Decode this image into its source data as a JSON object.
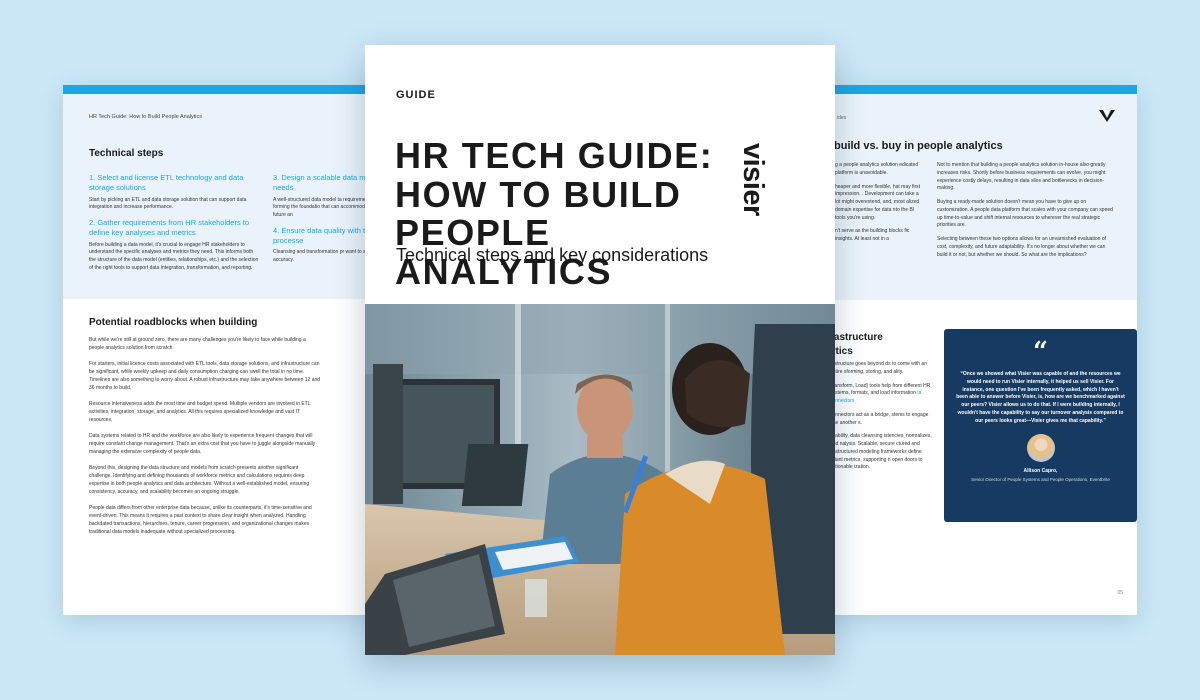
{
  "left_page": {
    "running_head": "HR Tech Guide: How to Build People Analytics",
    "technical_steps_title": "Technical steps",
    "steps_left": [
      {
        "heading": "1.  Select and license ETL technology and data storage solutions",
        "body": "Start by picking an ETL and data storage solution that can support data integration and increase performance."
      },
      {
        "heading": "2.  Gather requirements from HR stakeholders to define key analyses and metrics",
        "body": "Before building a data model, it's crucial to engage HR stakeholders to understand the specific analyses and metrics they need. This informs both the structure of the data model (entities, relationships, etc.) and the selection of the right tools to support data integration, transformation, and reporting."
      }
    ],
    "steps_right": [
      {
        "heading": "3.  Design a scalable data m your HR analytics needs",
        "body": "A well-structured data model ta requirements from stakeholders and rules, forming the foundatio that can accommodate back-da remaining scalable for future an"
      },
      {
        "heading": "4.  Ensure data quality with transformation processe",
        "body": "Cleansing and transformation pr want to standardize data, for inc data accuracy."
      }
    ],
    "roadblocks_title": "Potential roadblocks when building",
    "roadblocks_paragraphs": [
      "But while we're still at ground zero, there are many challenges you're likely to face while building a people analytics solution from scratch.",
      "For starters, initial licence costs associated with ETL tools, data storage solutions, and infrastructure can be significant, while weekly upkeep and daily consumption charging can swell the total in no time. Timelines are also something to worry about. A robust infrastructure may take anywhere between 12 and 36 months to build.",
      "Resource intensiveness adds the most time and budget spend. Multiple vendors are involved in ETL activities, integration, storage, and analytics. All this requires specialized knowledge and vast IT resources.",
      "Data systems related to HR and the workforce are also likely to experience frequent changes that will require constant change management. That's an extra cost that you have to juggle alongside manually managing the extensive complexity of people data.",
      "Beyond this, designing the data structure and models from scratch presents another significant challenge. Identifying and defining thousands of workforce metrics and calculations requires deep expertise in both people analytics and data architecture. Without a well-established model, ensuring consistency, accuracy, and scalability becomes an ongoing struggle.",
      "People data differs from other enterprise data because, unlike its counterparts, it's time-sensitive and event-driven. This means it requires a past context to share clear insight when analyzed. Handling backdated transactions, hierarchies, tenure, career progression, and organizational changes makes traditional data models inadequate without specialized processing."
    ]
  },
  "cover": {
    "guide_label": "GUIDE",
    "brand": "visier",
    "title_lines": [
      "HR TECH GUIDE:",
      "HOW TO BUILD",
      "PEOPLE ANALYTICS"
    ],
    "subtitle": "Technical steps and key considerations",
    "photo_description_icon": "office-photo"
  },
  "right_page": {
    "running_head": "ides",
    "title": "build vs. buy in people analytics",
    "col_a": [
      "g a people analytics solution edicated platform is unavoidable.",
      "heaper and more flexible, hat may first impression. . Development can take a lot might overextend, and, most alized domain expertise for data nto the BI tools you're using.",
      "n't serve as the building blocks fic insights. At least not in a"
    ],
    "col_b": [
      "Not to mention that building a people analytics solution in-house also greatly increases risks. Shortly before business requirements can evolve, you might experience costly delays, resulting in data silos and bottlenecks in decision-making.",
      "Buying a ready-made solution doesn't mean you have to give up on customization. A people data platform that scales with your company can speed up time-to-value and shift internal resources to wherever the real strategic priorities are.",
      "Selecting between these two options allows for an unvarnished evaluation of cost, complexity, and future adaptability. It's no longer about whether we can build it or not, but whether we should. So what are the implications?"
    ],
    "infra_title_lines": [
      "rastructure",
      "ytics"
    ],
    "col_c": [
      "rastructure goes beyond ds to come with an entire sforming, storing, and ality.",
      "Transform, Load) tools help from different HR systems, formats, and load information",
      "connectors act as a bridge, stems to engage one another s.",
      "eliability, data cleansing istencies, normalizes, and nalysis. Scalable, secure ctured and unstructured modeling frameworks define ortant metrics, supporting n open doors to actionable ization."
    ],
    "col_c_link": "ta connectors",
    "quote": {
      "mark": "“",
      "text": "“Once we showed what Visier was capable of and the resources we would need to run Visier internally, it helped us sell Visier. For instance, one question I've been frequently asked, which I haven't been able to answer before Visier, is, how are we benchmarked against our peers? Visier allows us to do that. If I were building internally, I wouldn't have the capability to say our turnover analysis compared to our peers looks great—Visier gives me that capability.”",
      "name": "Allison Capro,",
      "role": "Senior Director of People Systems and People Operations, Eventbrite"
    },
    "page_number": "05"
  },
  "colors": {
    "background": "#cce8f7",
    "accent": "#1ba6e8",
    "quote_card": "#173a62",
    "panel_tint": "#eaf3fb"
  }
}
